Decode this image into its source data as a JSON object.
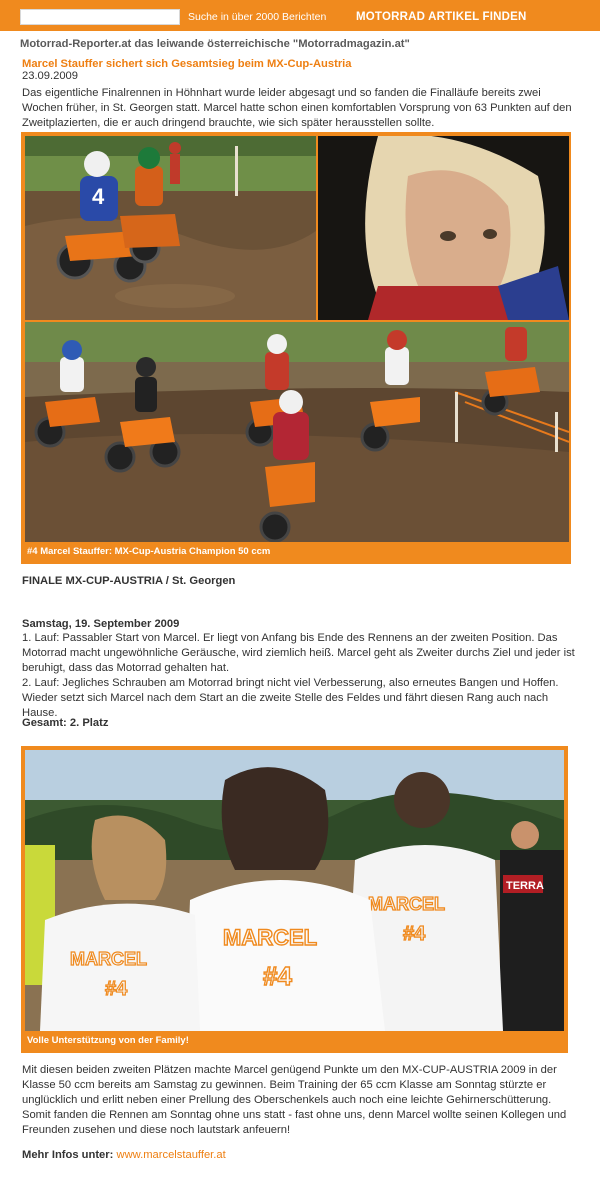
{
  "header": {
    "search_value": "",
    "search_hint": "Suche in über 2000 Berichten",
    "find_button": "MOTORRAD ARTIKEL FINDEN"
  },
  "tagline": "Motorrad-Reporter.at das leiwande österreichische \"Motorradmagazin.at\"",
  "article": {
    "title": "Marcel Stauffer sichert sich Gesamtsieg beim MX-Cup-Austria",
    "date": "23.09.2009",
    "lead": "Das eigentliche Finalrennen in Höhnhart wurde leider abgesagt und so fanden die Finalläufe bereits zwei Wochen früher, in St. Georgen statt. Marcel hatte schon einen komfortablen Vorsprung von 63 Punkten auf den Zweitplazierten, die er auch dringend brauchte, wie sich später herausstellen sollte.",
    "photo1": {
      "caption": "#4 Marcel Stauffer: MX-Cup-Austria Champion 50 ccm",
      "bib_number": "4"
    },
    "finale_heading": "FINALE MX-CUP-AUSTRIA / St. Georgen",
    "day_heading": "Samstag, 19. September 2009",
    "race1": "1. Lauf: Passabler Start von Marcel. Er liegt von Anfang bis Ende des Rennens an der zweiten Position. Das Motorrad macht ungewöhnliche Geräusche, wird ziemlich heiß. Marcel geht als Zweiter durchs Ziel und jeder ist beruhigt, dass das Motorrad gehalten hat.",
    "race2": "2. Lauf: Jegliches Schrauben am Motorrad bringt nicht viel Verbesserung, also erneutes Bangen und Hoffen. Wieder setzt sich Marcel nach dem Start an die zweite Stelle des Feldes und fährt diesen Rang auch nach Hause.",
    "overall": "Gesamt: 2. Platz",
    "photo2": {
      "caption": "Volle Unterstützung von der Family!",
      "shirt_name": "MARCEL",
      "shirt_number": "#4",
      "banner_text": "TERRA"
    },
    "closing": "Mit diesen beiden zweiten Plätzen machte Marcel genügend Punkte um den MX-CUP-AUSTRIA 2009 in der Klasse 50 ccm bereits am Samstag zu gewinnen. Beim Training der 65 ccm Klasse am Sonntag stürzte er unglücklich und erlitt neben einer Prellung des Oberschenkels auch noch eine leichte Gehirnerschütterung. Somit fanden die Rennen am Sonntag ohne uns statt - fast ohne uns, denn Marcel wollte seinen Kollegen und Freunden zusehen und diese noch lautstark anfeuern!",
    "more_info_label": "Mehr Infos unter:",
    "more_info_link": "www.marcelstauffer.at"
  },
  "colors": {
    "brand_orange": "#f08a1e",
    "title_orange": "#ee7f12"
  }
}
